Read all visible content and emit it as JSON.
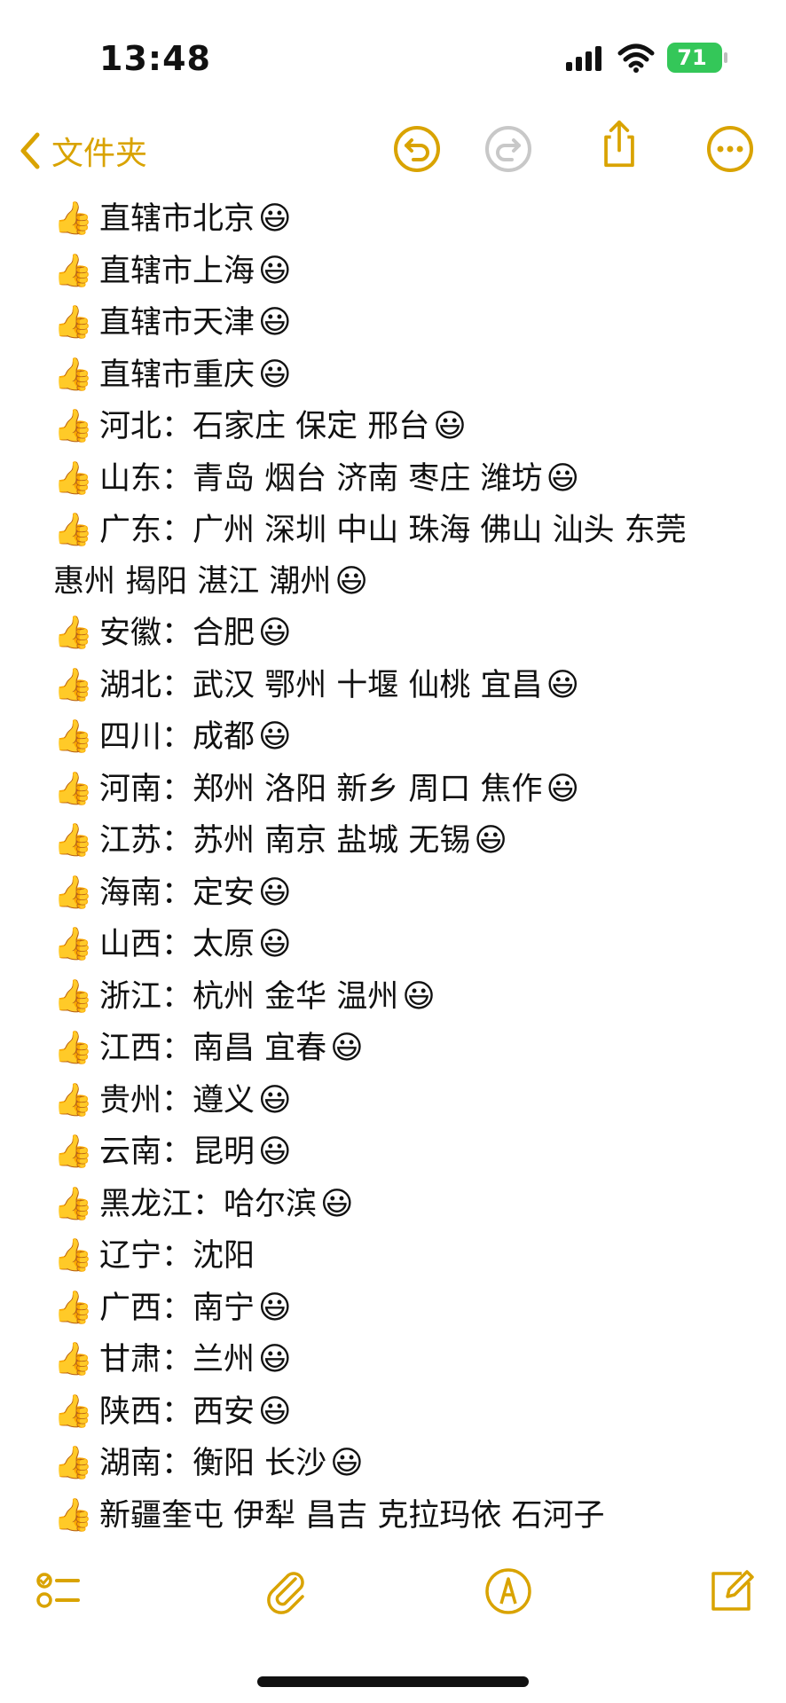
{
  "status": {
    "time": "13:48",
    "battery": "71"
  },
  "nav": {
    "back_label": "文件夹"
  },
  "icons": {
    "thumb": "👍",
    "smile": "😃"
  },
  "rows": [
    {
      "text": "直辖市北京",
      "smile": true
    },
    {
      "text": "直辖市上海",
      "smile": true
    },
    {
      "text": "直辖市天津",
      "smile": true
    },
    {
      "text": "直辖市重庆",
      "smile": true
    },
    {
      "text": "河北：石家庄 保定 邢台",
      "smile": true
    },
    {
      "text": "山东：青岛 烟台 济南 枣庄 潍坊",
      "smile": true
    },
    {
      "text": "广东：广州 深圳 中山 珠海 佛山 汕头 东莞",
      "text2": "惠州 揭阳 湛江 潮州",
      "smile": true
    },
    {
      "text": "安徽：合肥",
      "smile": true
    },
    {
      "text": "湖北：武汉 鄂州 十堰 仙桃 宜昌",
      "smile": true
    },
    {
      "text": "四川：成都",
      "smile": true
    },
    {
      "text": "河南：郑州 洛阳 新乡 周口 焦作",
      "smile": true
    },
    {
      "text": "江苏：苏州 南京 盐城 无锡",
      "smile": true
    },
    {
      "text": "海南：定安",
      "smile": true
    },
    {
      "text": "山西：太原",
      "smile": true
    },
    {
      "text": "浙江：杭州 金华 温州",
      "smile": true
    },
    {
      "text": "江西：南昌 宜春",
      "smile": true
    },
    {
      "text": "贵州：遵义",
      "smile": true
    },
    {
      "text": "云南：昆明",
      "smile": true
    },
    {
      "text": "黑龙江：哈尔滨",
      "smile": true
    },
    {
      "text": "辽宁：沈阳",
      "smile": false
    },
    {
      "text": "广西：南宁",
      "smile": true
    },
    {
      "text": "甘肃：兰州",
      "smile": true
    },
    {
      "text": "陕西：西安",
      "smile": true
    },
    {
      "text": "湖南：衡阳 长沙",
      "smile": true
    },
    {
      "text": "新疆奎屯 伊犁 昌吉 克拉玛依 石河子",
      "smile": false
    }
  ],
  "colors": {
    "accent": "#d9a300",
    "battery": "#34c759"
  }
}
